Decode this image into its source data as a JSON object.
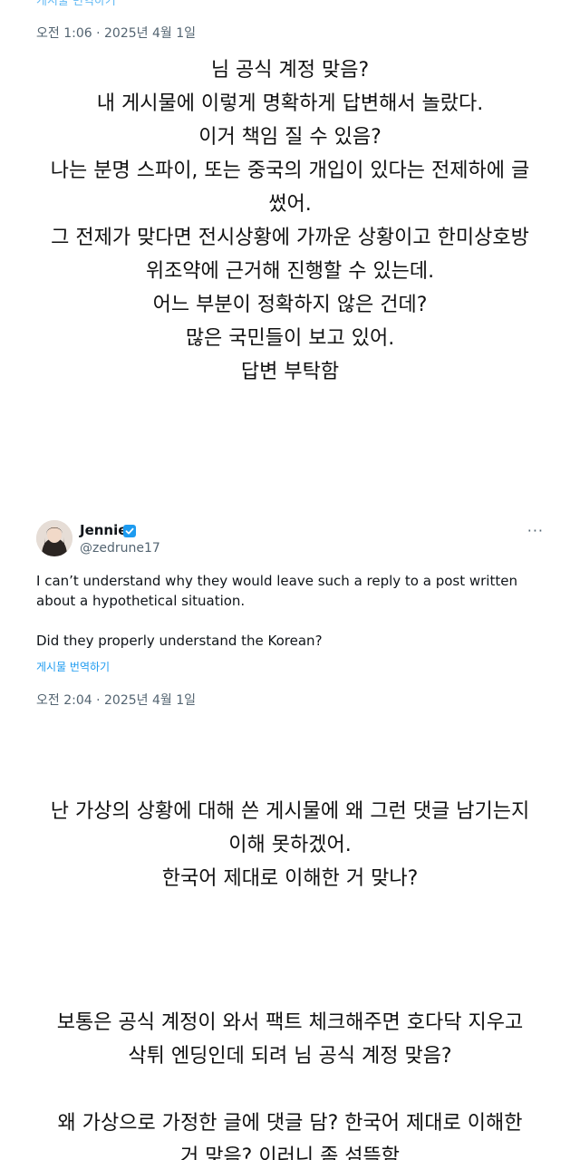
{
  "top": {
    "translate_link": "게시물 번역하기",
    "timestamp": "오전 1:06 · 2025년 4월 1일"
  },
  "caption1": [
    "님 공식 계정 맞음?",
    "내 게시물에 이렇게 명확하게 답변해서 놀랐다.",
    "이거 책임 질 수 있음?",
    "나는 분명 스파이, 또는 중국의 개입이 있다는 전제하에 글",
    "썼어.",
    "그 전제가 맞다면 전시상황에 가까운 상황이고 한미상호방",
    "위조약에 근거해 진행할 수 있는데.",
    "어느 부분이 정확하지 않은 건데?",
    "많은 국민들이 보고 있어.",
    "답변 부탁함"
  ],
  "tweet": {
    "author_name": "Jennie",
    "handle": "@zedrune17",
    "more_label": "···",
    "body_line1": "I can’t understand why they would leave such a reply to a post written",
    "body_line2": "about a hypothetical situation.",
    "body_line3": "Did they properly understand the Korean?",
    "translate_link": "게시물 번역하기",
    "timestamp": "오전 2:04 · 2025년 4월 1일"
  },
  "caption2": [
    "난 가상의 상황에 대해 쓴 게시물에 왜 그런 댓글 남기는지",
    "이해 못하겠어.",
    "한국어 제대로 이해한 거 맞나?"
  ],
  "caption3": [
    "보통은 공식 계정이 와서 팩트 체크해주면 호다닥 지우고",
    "삭튀 엔딩인데 되려 님 공식 계정 맞음?",
    "",
    "왜 가상으로 가정한 글에 댓글 담? 한국어 제대로 이해한",
    "거 맞음? 이러니 좀 섬뜩함"
  ],
  "colors": {
    "link": "#1d9bf0",
    "muted": "#536471",
    "verified": "#1d9bf0"
  },
  "icons": {
    "verified": "verified-badge-icon",
    "more": "more-dots-icon"
  }
}
